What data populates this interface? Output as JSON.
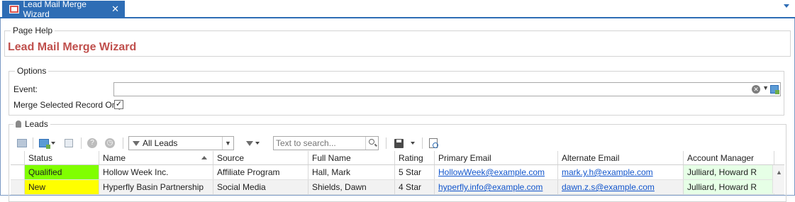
{
  "tab": {
    "title": "Lead Mail Merge Wizard",
    "close_glyph": "✕"
  },
  "page_help": {
    "legend": "Page Help",
    "title": "Lead Mail Merge Wizard"
  },
  "options": {
    "legend": "Options",
    "event_label": "Event:",
    "event_value": "",
    "merge_selected_label": "Merge Selected Record Only",
    "merge_selected_checked": true
  },
  "leads": {
    "legend": "Leads",
    "view_selected": "All Leads",
    "search_placeholder": "Text to search...",
    "columns": [
      "Status",
      "Name",
      "Source",
      "Full Name",
      "Rating",
      "Primary Email",
      "Alternate Email",
      "Account Manager"
    ],
    "sorted_column": "Name",
    "rows": [
      {
        "status": "Qualified",
        "name": "Hollow Week Inc.",
        "source": "Affiliate Program",
        "full_name": "Hall, Mark",
        "rating": "5 Star",
        "primary_email": "HollowWeek@example.com",
        "alternate_email": "mark.y.h@example.com",
        "account_manager": "Julliard, Howard R"
      },
      {
        "status": "New",
        "name": "Hyperfly Basin Partnership",
        "source": "Social Media",
        "full_name": "Shields, Dawn",
        "rating": "4 Star",
        "primary_email": "hyperfly.info@example.com",
        "alternate_email": "dawn.z.s@example.com",
        "account_manager": "Julliard, Howard R"
      }
    ]
  },
  "colors": {
    "accent": "#2e6db5",
    "title_red": "#c0504d",
    "status_qualified": "#80ff00",
    "status_new": "#ffff00",
    "account_manager_bg": "#e6ffe6"
  },
  "icons": [
    "lead-mail-merge-tab-icon",
    "tab-close-icon",
    "tab-overflow-dropdown-icon",
    "clear-icon",
    "dropdown-arrow-icon",
    "lookup-book-icon",
    "checkmark-icon",
    "person-icon",
    "grid-layout-icon",
    "new-record-icon",
    "copy-icon",
    "help-icon",
    "history-icon",
    "filter-funnel-icon",
    "search-icon",
    "save-icon",
    "report-designer-icon",
    "sort-ascending-icon"
  ]
}
